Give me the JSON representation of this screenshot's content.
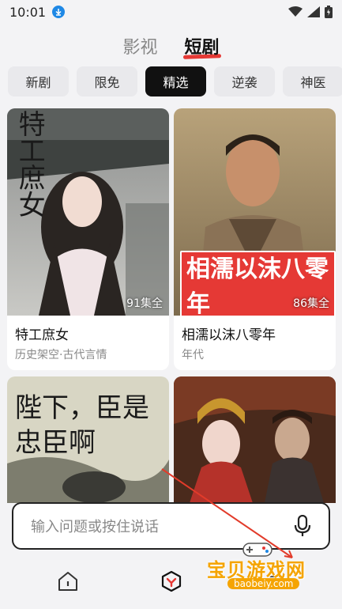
{
  "status_bar": {
    "time": "10:01"
  },
  "top_tabs": [
    {
      "label": "影视",
      "active": false
    },
    {
      "label": "短剧",
      "active": true
    }
  ],
  "chips": [
    {
      "label": "新剧",
      "active": false
    },
    {
      "label": "限免",
      "active": false
    },
    {
      "label": "精选",
      "active": true
    },
    {
      "label": "逆袭",
      "active": false
    },
    {
      "label": "神医",
      "active": false
    }
  ],
  "cards": [
    {
      "title": "特工庶女",
      "tags": "历史架空·古代言情",
      "episodes": "91集全",
      "poster_text": "特工庶女"
    },
    {
      "title": "相濡以沫八零年",
      "tags": "年代",
      "episodes": "86集全",
      "poster_text": "相濡以沫八零年"
    },
    {
      "title": "",
      "tags": "",
      "episodes": "",
      "poster_text": "陛下，臣是忠臣啊"
    },
    {
      "title": "",
      "tags": "",
      "episodes": "",
      "poster_text": ""
    }
  ],
  "search": {
    "placeholder": "输入问题或按住说话"
  },
  "watermark": {
    "text": "宝贝游戏网",
    "url": "baobeiy.com"
  },
  "colors": {
    "accent": "#e53935",
    "active_chip": "#111111",
    "watermark": "#f5a400"
  }
}
